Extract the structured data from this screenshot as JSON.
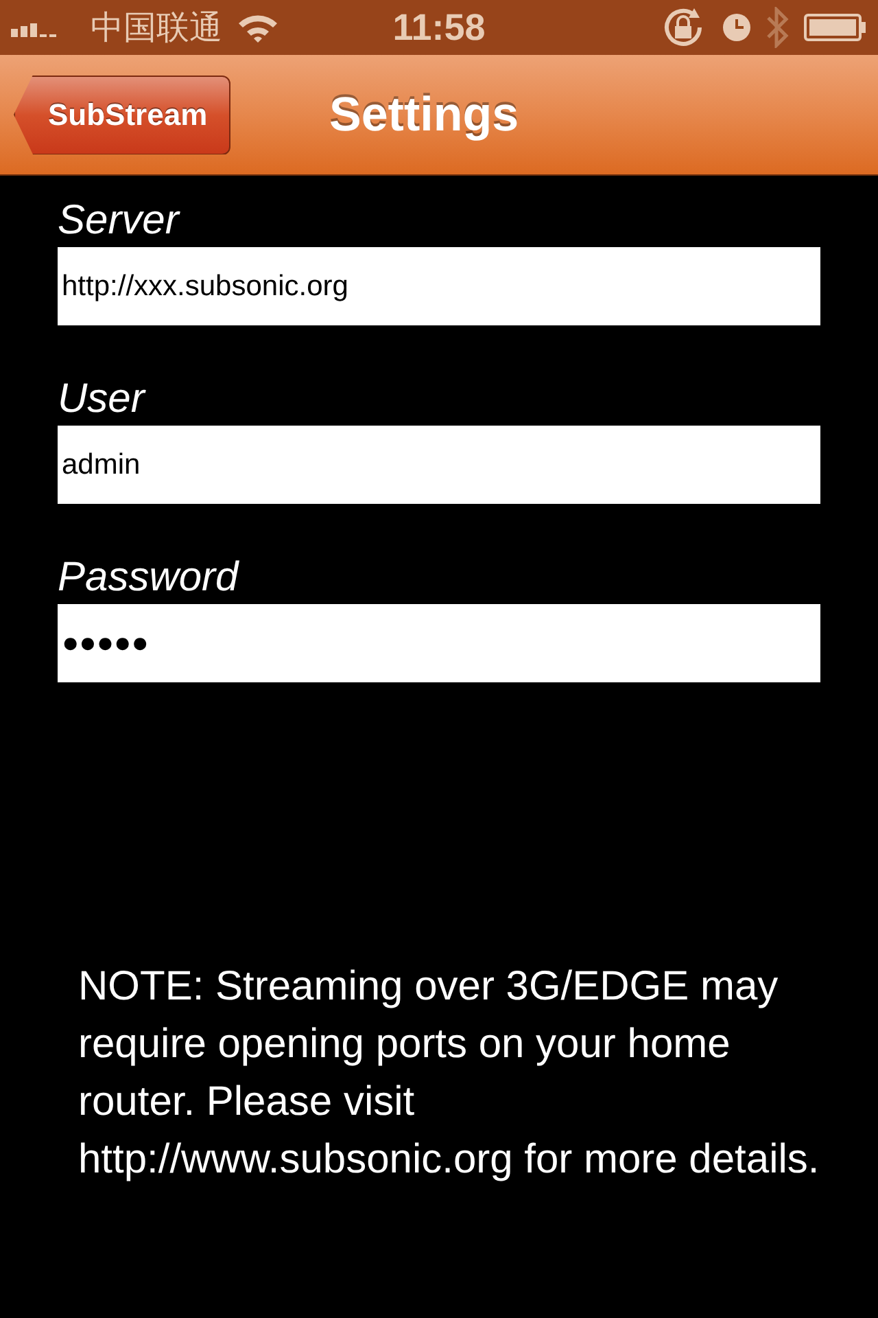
{
  "status_bar": {
    "carrier": "中国联通",
    "time": "11:58"
  },
  "nav_bar": {
    "back_button": "SubStream",
    "title": "Settings"
  },
  "fields": [
    {
      "label": "Server",
      "value": "http://xxx.subsonic.org"
    },
    {
      "label": "User",
      "value": "admin"
    },
    {
      "label": "Password",
      "value": "●●●●●"
    }
  ],
  "note": "NOTE: Streaming over 3G/EDGE may require opening ports on your home router.  Please visit http://www.subsonic.org for more details."
}
